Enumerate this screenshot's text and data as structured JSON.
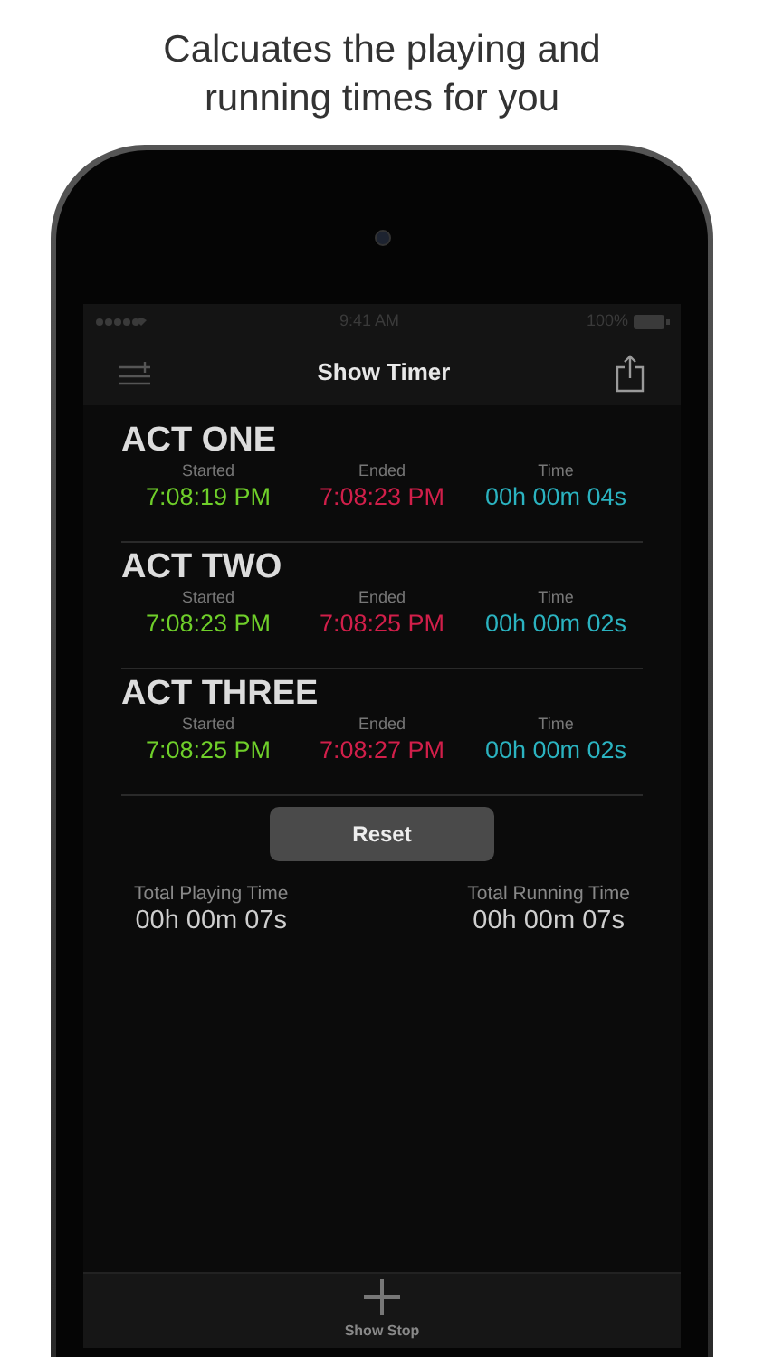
{
  "caption": "Calcuates the playing and running times for you",
  "status_bar": {
    "time": "9:41 AM",
    "battery": "100%"
  },
  "nav": {
    "title": "Show Timer"
  },
  "acts": [
    {
      "name": "ACT ONE",
      "fields": [
        {
          "kind": "start",
          "label": "Started",
          "value": "7:08:19 PM"
        },
        {
          "kind": "end",
          "label": "Ended",
          "value": "7:08:23 PM"
        },
        {
          "kind": "duration",
          "label": "Time",
          "value": "00h 00m 04s"
        }
      ]
    },
    {
      "name": "ACT TWO",
      "fields": [
        {
          "kind": "start",
          "label": "Started",
          "value": "7:08:23 PM"
        },
        {
          "kind": "end",
          "label": "Ended",
          "value": "7:08:25 PM"
        },
        {
          "kind": "duration",
          "label": "Time",
          "value": "00h 00m 02s"
        }
      ]
    },
    {
      "name": "ACT THREE",
      "fields": [
        {
          "kind": "start",
          "label": "Started",
          "value": "7:08:25 PM"
        },
        {
          "kind": "end",
          "label": "Ended",
          "value": "7:08:27 PM"
        },
        {
          "kind": "duration",
          "label": "Time",
          "value": "00h 00m 02s"
        }
      ]
    }
  ],
  "reset_button": "Reset",
  "totals": [
    {
      "label": "Total Playing Time",
      "value": "00h 00m 07s"
    },
    {
      "label": "Total Running Time",
      "value": "00h 00m 07s"
    }
  ],
  "toolbar": {
    "label": "Show Stop"
  }
}
